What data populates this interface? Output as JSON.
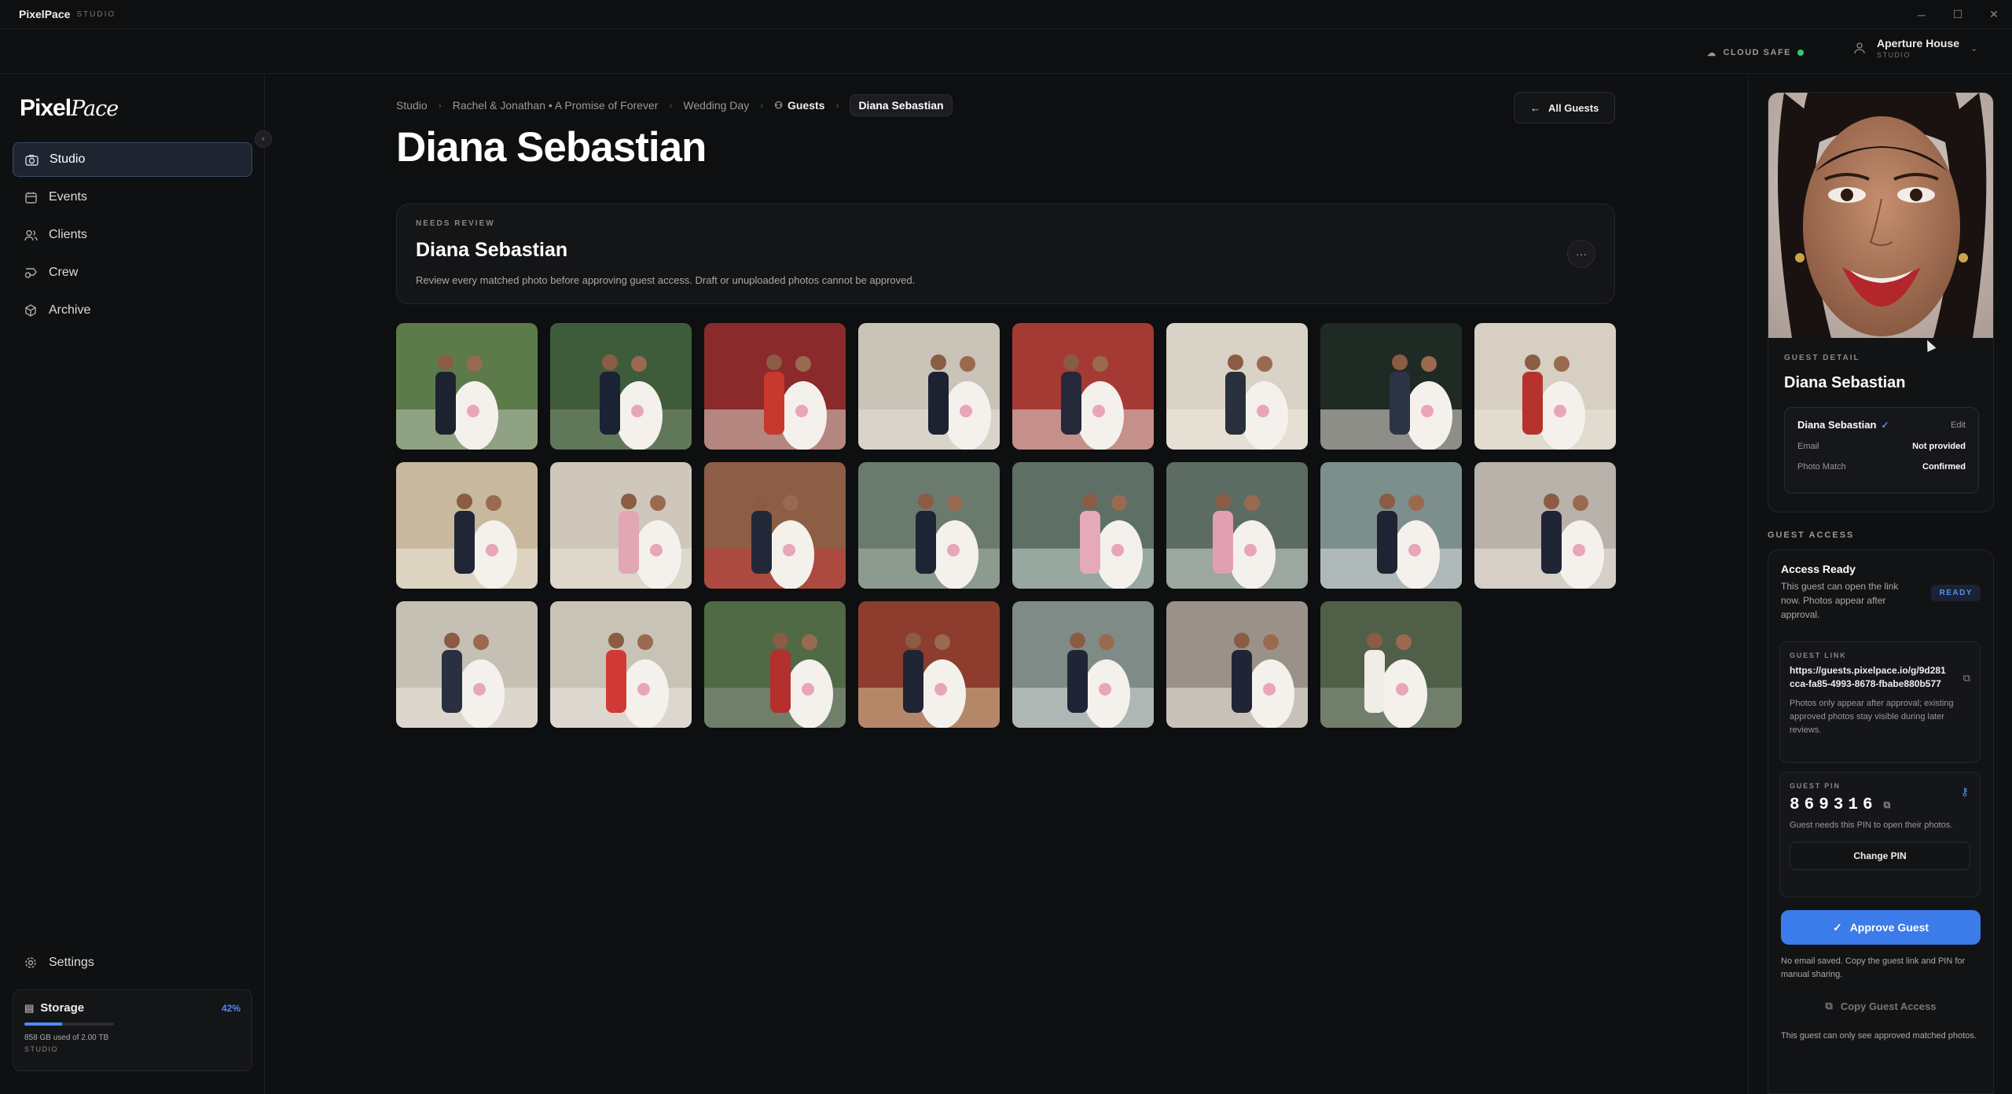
{
  "app": {
    "name": "PixelPace",
    "sub": "STUDIO"
  },
  "window": {
    "minimize": "─",
    "maximize": "☐",
    "close": "✕"
  },
  "topbar": {
    "cloud": "CLOUD SAFE",
    "user_name": "Aperture House",
    "user_role": "STUDIO"
  },
  "sidebar": {
    "logo_a": "Pixel",
    "logo_b": "Pace",
    "items": [
      {
        "label": "Studio",
        "icon": "camera-icon",
        "active": true
      },
      {
        "label": "Events",
        "icon": "calendar-icon"
      },
      {
        "label": "Clients",
        "icon": "users-icon"
      },
      {
        "label": "Crew",
        "icon": "badge-icon"
      },
      {
        "label": "Archive",
        "icon": "archive-icon"
      }
    ],
    "settings": "Settings",
    "storage": {
      "label": "Storage",
      "percent_text": "42%",
      "percent": 0.42,
      "used": "858 GB used of 2.00 TB",
      "plan": "STUDIO"
    }
  },
  "breadcrumb": {
    "studio": "Studio",
    "event": "Rachel & Jonathan • A Promise of Forever",
    "day": "Wedding Day",
    "guests": "Guests",
    "current": "Diana Sebastian"
  },
  "page": {
    "title": "Diana Sebastian",
    "all_guests": "All Guests"
  },
  "review": {
    "tag": "NEEDS REVIEW",
    "name": "Diana Sebastian",
    "desc": "Review every matched photo before approving guest access. Draft or unuploaded photos cannot be approved.",
    "more": "···"
  },
  "photos_count": 23,
  "guest_detail": {
    "tag": "GUEST DETAIL",
    "name": "Diana Sebastian",
    "box_name": "Diana Sebastian",
    "edit": "Edit",
    "email_label": "Email",
    "email_value": "Not provided",
    "match_label": "Photo Match",
    "match_value": "Confirmed"
  },
  "guest_access": {
    "tag": "GUEST ACCESS",
    "title": "Access Ready",
    "desc": "This guest can open the link now. Photos appear after approval.",
    "badge": "READY",
    "link_tag": "GUEST LINK",
    "link": "https://guests.pixelpace.io/g/9d281cca-fa85-4993-8678-fbabe880b577",
    "link_note": "Photos only appear after approval; existing approved photos stay visible during later reviews.",
    "pin_tag": "GUEST PIN",
    "pin": "869316",
    "pin_note": "Guest needs this PIN to open their photos.",
    "change_pin": "Change PIN",
    "approve": "Approve Guest",
    "no_email": "No email saved. Copy the guest link and PIN for manual sharing.",
    "copy_access": "Copy Guest Access",
    "only_see": "This guest can only see approved matched photos."
  },
  "colors": {
    "accent": "#3b7bea",
    "ready": "#5a8ef0",
    "cloud_ok": "#2ecc71"
  }
}
